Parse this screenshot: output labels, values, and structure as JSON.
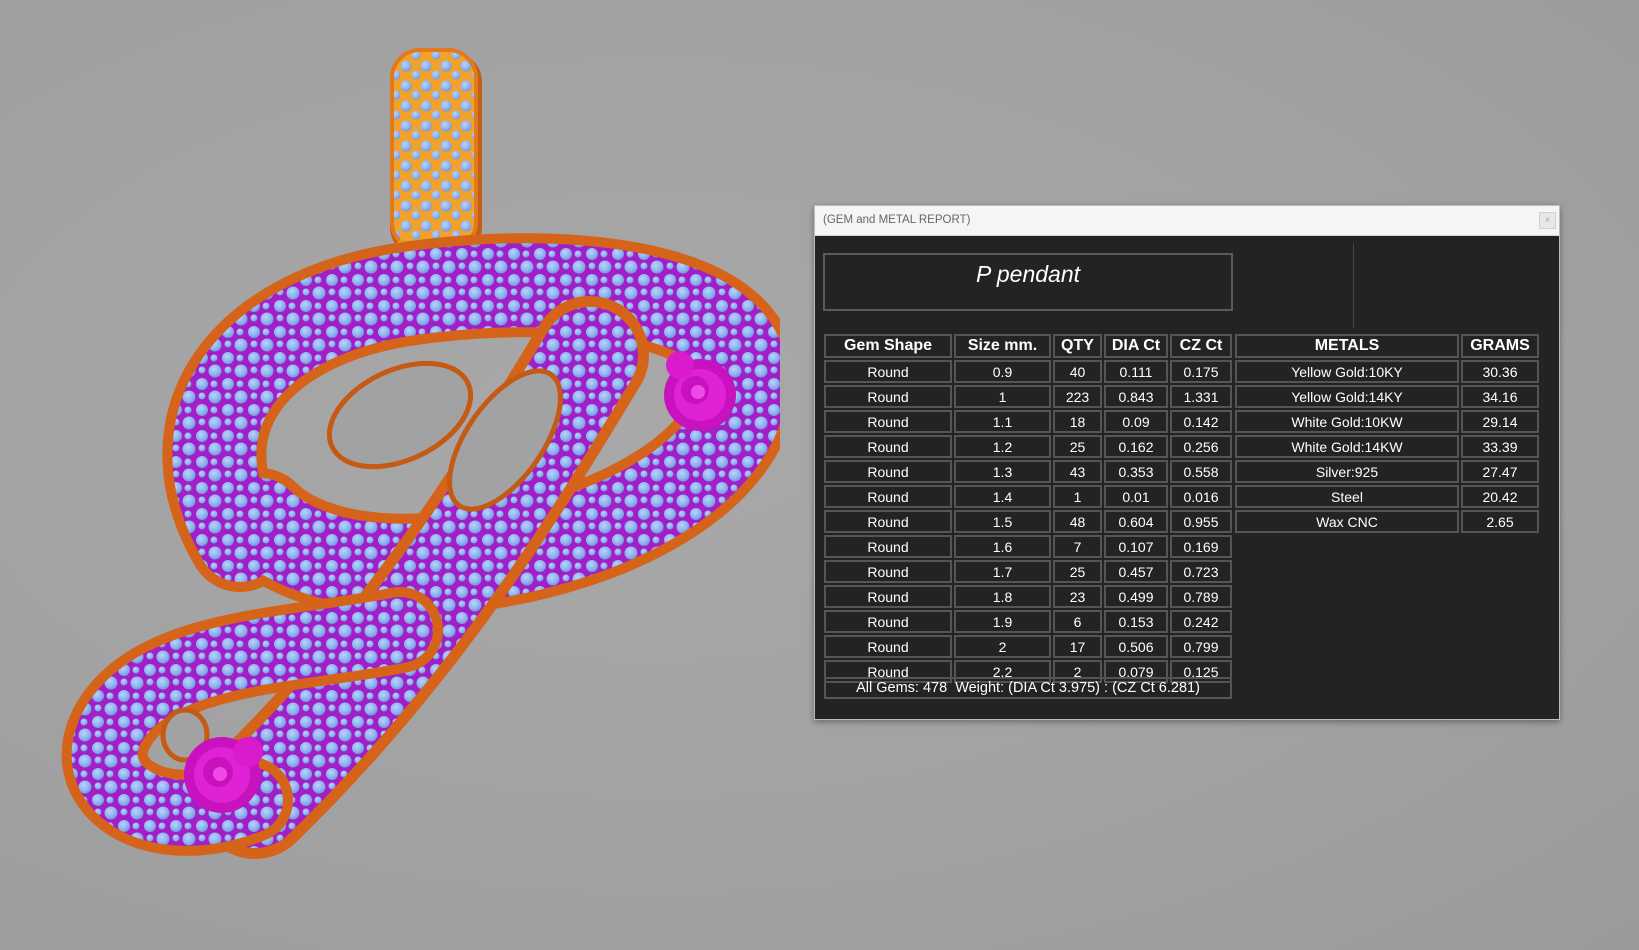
{
  "window": {
    "title": "(GEM and METAL REPORT)",
    "close_symbol": "×"
  },
  "product_name": "P pendant",
  "gems_table": {
    "headers": [
      "Gem Shape",
      "Size mm.",
      "QTY",
      "DIA Ct",
      "CZ Ct"
    ],
    "rows": [
      [
        "Round",
        "0.9",
        "40",
        "0.111",
        "0.175"
      ],
      [
        "Round",
        "1",
        "223",
        "0.843",
        "1.331"
      ],
      [
        "Round",
        "1.1",
        "18",
        "0.09",
        "0.142"
      ],
      [
        "Round",
        "1.2",
        "25",
        "0.162",
        "0.256"
      ],
      [
        "Round",
        "1.3",
        "43",
        "0.353",
        "0.558"
      ],
      [
        "Round",
        "1.4",
        "1",
        "0.01",
        "0.016"
      ],
      [
        "Round",
        "1.5",
        "48",
        "0.604",
        "0.955"
      ],
      [
        "Round",
        "1.6",
        "7",
        "0.107",
        "0.169"
      ],
      [
        "Round",
        "1.7",
        "25",
        "0.457",
        "0.723"
      ],
      [
        "Round",
        "1.8",
        "23",
        "0.499",
        "0.789"
      ],
      [
        "Round",
        "1.9",
        "6",
        "0.153",
        "0.242"
      ],
      [
        "Round",
        "2",
        "17",
        "0.506",
        "0.799"
      ],
      [
        "Round",
        "2.2",
        "2",
        "0.079",
        "0.125"
      ]
    ]
  },
  "summary": "All Gems: 478  Weight: (DIA Ct 3.975) : (CZ Ct 6.281)",
  "metals_table": {
    "headers": [
      "METALS",
      "GRAMS"
    ],
    "rows": [
      [
        "Yellow Gold:10KY",
        "30.36"
      ],
      [
        "Yellow Gold:14KY",
        "34.16"
      ],
      [
        "White Gold:10KW",
        "29.14"
      ],
      [
        "White Gold:14KW",
        "33.39"
      ],
      [
        "Silver:925",
        "27.47"
      ],
      [
        "Steel",
        "20.42"
      ],
      [
        "Wax  CNC",
        "2.65"
      ]
    ]
  },
  "colors": {
    "background": "#a3a2a3",
    "metal_gold": "#f0a020",
    "metal_orange": "#e2741e",
    "gem_blue": "#8fb4f2",
    "setting_purple": "#a020c8",
    "rose_magenta": "#e022d6",
    "panel_bg": "#232323"
  }
}
